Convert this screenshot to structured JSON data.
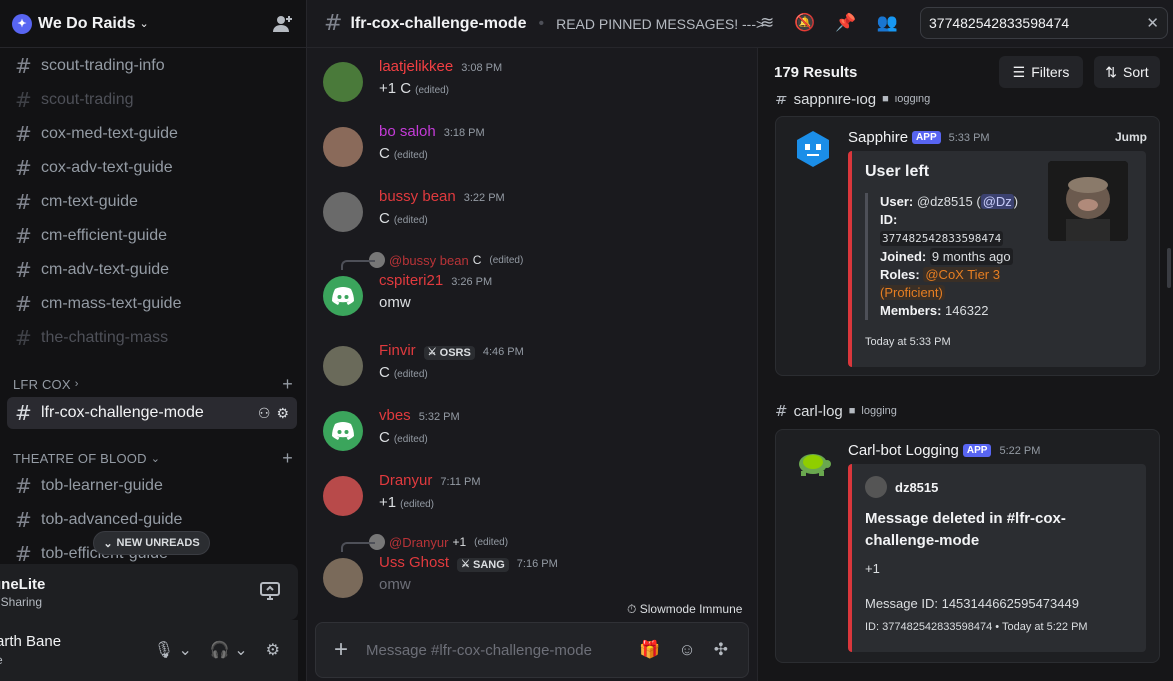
{
  "server": {
    "name": "We Do Raids"
  },
  "sidebar": {
    "channels_top": [
      {
        "name": "scout-trading-info",
        "muted": false
      },
      {
        "name": "scout-trading",
        "muted": true
      },
      {
        "name": "cox-med-text-guide",
        "muted": false
      },
      {
        "name": "cox-adv-text-guide",
        "muted": false
      },
      {
        "name": "cm-text-guide",
        "muted": false
      },
      {
        "name": "cm-efficient-guide",
        "muted": false
      },
      {
        "name": "cm-adv-text-guide",
        "muted": false
      },
      {
        "name": "cm-mass-text-guide",
        "muted": false
      },
      {
        "name": "the-chatting-mass",
        "muted": true
      }
    ],
    "category_lfr": "LFR COX",
    "active_channel": "lfr-cox-challenge-mode",
    "category_tob": "THEATRE OF BLOOD",
    "channels_tob": [
      {
        "name": "tob-learner-guide"
      },
      {
        "name": "tob-advanced-guide"
      },
      {
        "name": "tob-efficient-guide"
      }
    ],
    "new_unreads": "NEW UNREADS"
  },
  "voice_panel": {
    "title": "uneLite",
    "subtitle": "t Sharing"
  },
  "user_panel": {
    "name": "arth Bane",
    "sub": "e"
  },
  "topbar": {
    "channel": "lfr-cox-challenge-mode",
    "topic": "READ PINNED MESSAGES! --->",
    "search_value": "377482542833598474"
  },
  "messages": [
    {
      "user": "laatjelikkee",
      "color": "#f23f43",
      "time": "3:08 PM",
      "text": "+1 C",
      "edited": "(edited)"
    },
    {
      "user": "bo saloh",
      "color": "#c43bd8",
      "time": "3:18 PM",
      "text": "C",
      "edited": "(edited)"
    },
    {
      "user": "bussy bean",
      "color": "#e03a3e",
      "time": "3:22 PM",
      "text": "C",
      "edited": "(edited)"
    },
    {
      "user": "cspiteri21",
      "color": "#e03a3e",
      "time": "3:26 PM",
      "text": "omw",
      "edited": "",
      "reply_user": "@bussy bean",
      "reply_text": "C",
      "reply_edited": "(edited)"
    },
    {
      "user": "Finvir",
      "color": "#e03a3e",
      "time": "4:46 PM",
      "text": "C",
      "edited": "(edited)",
      "tag": "OSRS"
    },
    {
      "user": "vbes",
      "color": "#e03a3e",
      "time": "5:32 PM",
      "text": "C",
      "edited": "(edited)"
    },
    {
      "user": "Dranyur",
      "color": "#e03a3e",
      "time": "7:11 PM",
      "text": "+1",
      "edited": "(edited)"
    },
    {
      "user": "Uss Ghost",
      "color": "#e03a3e",
      "time": "7:16 PM",
      "text": "omw",
      "edited": "",
      "tag": "SANG",
      "reply_user": "@Dranyur",
      "reply_text": "+1",
      "reply_edited": "(edited)"
    }
  ],
  "slowmode": "Slowmode Immune",
  "composer": {
    "placeholder": "Message #lfr-cox-challenge-mode"
  },
  "results": {
    "count": "179 Results",
    "filters": "Filters",
    "sort": "Sort",
    "group1": {
      "channel": "sapphire-log",
      "category": "logging"
    },
    "card1": {
      "bot": "Sapphire",
      "app": "APP",
      "time": "5:33 PM",
      "jump": "Jump",
      "title": "User left",
      "user_label": "User:",
      "user_val": "@dz8515",
      "user_mention": "@Dz",
      "id_label": "ID:",
      "id_val": "377482542833598474",
      "joined_label": "Joined:",
      "joined_val": "9 months ago",
      "roles_label": "Roles:",
      "roles_val": "@CoX Tier 3 (Proficient)",
      "members_label": "Members:",
      "members_val": "146322",
      "footer": "Today at 5:33 PM"
    },
    "group2": {
      "channel": "carl-log",
      "category": "logging"
    },
    "card2": {
      "bot": "Carl-bot Logging",
      "app": "APP",
      "time": "5:22 PM",
      "author": "dz8515",
      "title": "Message deleted in #lfr-cox-challenge-mode",
      "content": "+1",
      "msg_id": "Message ID: 1453144662595473449",
      "footer": "ID: 377482542833598474 • Today at 5:22 PM"
    }
  }
}
